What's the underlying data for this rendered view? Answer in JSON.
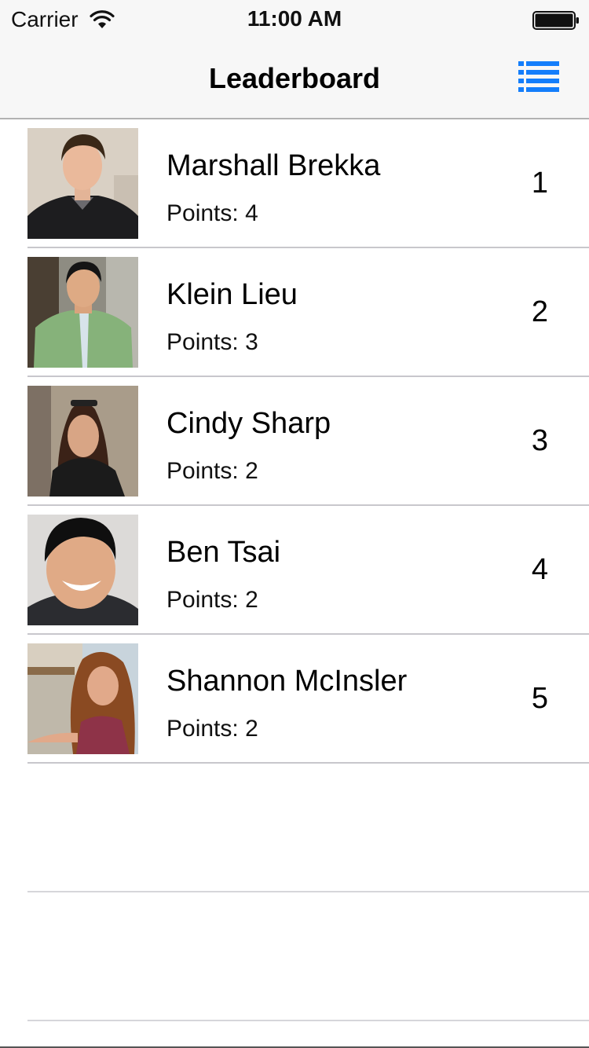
{
  "status_bar": {
    "carrier": "Carrier",
    "time": "11:00 AM",
    "icons": [
      "wifi-icon",
      "battery-icon"
    ]
  },
  "nav": {
    "title": "Leaderboard",
    "right_icon": "list-icon",
    "accent_color": "#147efb"
  },
  "leaderboard": {
    "points_label": "Points:",
    "rows": [
      {
        "name": "Marshall Brekka",
        "points": "4",
        "rank": "1"
      },
      {
        "name": "Klein Lieu",
        "points": "3",
        "rank": "2"
      },
      {
        "name": "Cindy Sharp",
        "points": "2",
        "rank": "3"
      },
      {
        "name": "Ben Tsai",
        "points": "2",
        "rank": "4"
      },
      {
        "name": "Shannon McInsler",
        "points": "2",
        "rank": "5"
      }
    ]
  }
}
